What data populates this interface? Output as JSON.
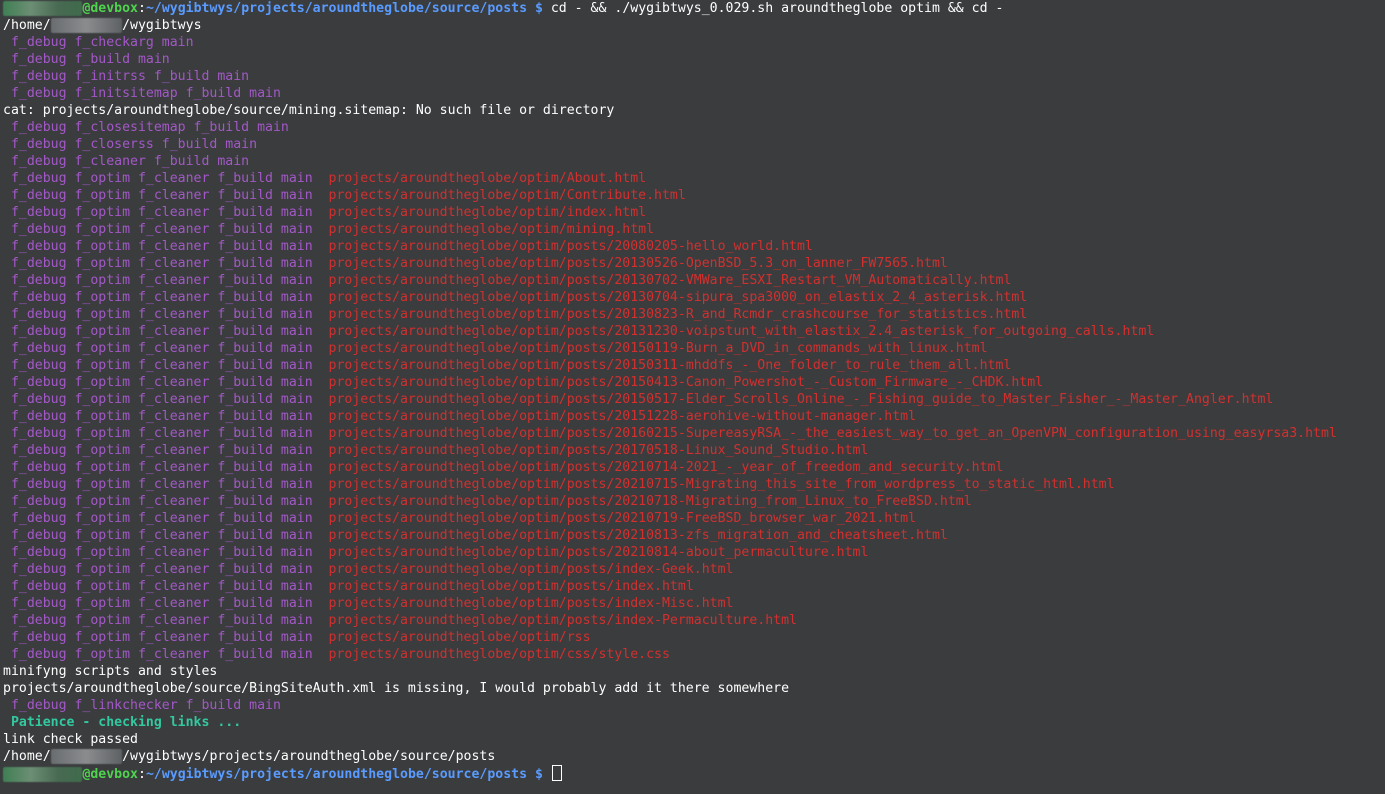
{
  "terminal": {
    "lines": [
      [
        {
          "c": "redact",
          "t": "xxxxxxxxxx"
        },
        {
          "c": "green",
          "t": "@devbox"
        },
        {
          "c": "white",
          "t": ":"
        },
        {
          "c": "blue",
          "t": "~/wygibtwys/projects/aroundtheglobe/source/posts $"
        },
        {
          "c": "white",
          "t": " cd - && ./wygibtwys_0.029.sh aroundtheglobe optim && cd -"
        }
      ],
      [
        {
          "c": "white",
          "t": "/home/"
        },
        {
          "c": "redact-grey",
          "t": "xxxxxxxxx"
        },
        {
          "c": "white",
          "t": "/wygibtwys"
        }
      ],
      [
        {
          "c": "purple",
          "t": " f_debug f_checkarg main"
        }
      ],
      [
        {
          "c": "purple",
          "t": " f_debug f_build main"
        }
      ],
      [
        {
          "c": "purple",
          "t": " f_debug f_initrss f_build main"
        }
      ],
      [
        {
          "c": "purple",
          "t": " f_debug f_initsitemap f_build main"
        }
      ],
      [
        {
          "c": "white",
          "t": "cat: projects/aroundtheglobe/source/mining.sitemap: No such file or directory"
        }
      ],
      [
        {
          "c": "purple",
          "t": " f_debug f_closesitemap f_build main"
        }
      ],
      [
        {
          "c": "purple",
          "t": " f_debug f_closerss f_build main"
        }
      ],
      [
        {
          "c": "purple",
          "t": " f_debug f_cleaner f_build main"
        }
      ],
      [
        {
          "c": "purple",
          "t": " f_debug f_optim f_cleaner f_build main "
        },
        {
          "c": "red",
          "t": " projects/aroundtheglobe/optim/About.html"
        }
      ],
      [
        {
          "c": "purple",
          "t": " f_debug f_optim f_cleaner f_build main "
        },
        {
          "c": "red",
          "t": " projects/aroundtheglobe/optim/Contribute.html"
        }
      ],
      [
        {
          "c": "purple",
          "t": " f_debug f_optim f_cleaner f_build main "
        },
        {
          "c": "red",
          "t": " projects/aroundtheglobe/optim/index.html"
        }
      ],
      [
        {
          "c": "purple",
          "t": " f_debug f_optim f_cleaner f_build main "
        },
        {
          "c": "red",
          "t": " projects/aroundtheglobe/optim/mining.html"
        }
      ],
      [
        {
          "c": "purple",
          "t": " f_debug f_optim f_cleaner f_build main "
        },
        {
          "c": "red",
          "t": " projects/aroundtheglobe/optim/posts/20080205-hello_world.html"
        }
      ],
      [
        {
          "c": "purple",
          "t": " f_debug f_optim f_cleaner f_build main "
        },
        {
          "c": "red",
          "t": " projects/aroundtheglobe/optim/posts/20130526-OpenBSD_5.3_on_lanner_FW7565.html"
        }
      ],
      [
        {
          "c": "purple",
          "t": " f_debug f_optim f_cleaner f_build main "
        },
        {
          "c": "red",
          "t": " projects/aroundtheglobe/optim/posts/20130702-VMWare_ESXI_Restart_VM_Automatically.html"
        }
      ],
      [
        {
          "c": "purple",
          "t": " f_debug f_optim f_cleaner f_build main "
        },
        {
          "c": "red",
          "t": " projects/aroundtheglobe/optim/posts/20130704-sipura_spa3000_on_elastix_2_4_asterisk.html"
        }
      ],
      [
        {
          "c": "purple",
          "t": " f_debug f_optim f_cleaner f_build main "
        },
        {
          "c": "red",
          "t": " projects/aroundtheglobe/optim/posts/20130823-R_and_Rcmdr_crashcourse_for_statistics.html"
        }
      ],
      [
        {
          "c": "purple",
          "t": " f_debug f_optim f_cleaner f_build main "
        },
        {
          "c": "red",
          "t": " projects/aroundtheglobe/optim/posts/20131230-voipstunt_with_elastix_2.4_asterisk_for_outgoing_calls.html"
        }
      ],
      [
        {
          "c": "purple",
          "t": " f_debug f_optim f_cleaner f_build main "
        },
        {
          "c": "red",
          "t": " projects/aroundtheglobe/optim/posts/20150119-Burn_a_DVD_in_commands_with_linux.html"
        }
      ],
      [
        {
          "c": "purple",
          "t": " f_debug f_optim f_cleaner f_build main "
        },
        {
          "c": "red",
          "t": " projects/aroundtheglobe/optim/posts/20150311-mhddfs_-_One_folder_to_rule_them_all.html"
        }
      ],
      [
        {
          "c": "purple",
          "t": " f_debug f_optim f_cleaner f_build main "
        },
        {
          "c": "red",
          "t": " projects/aroundtheglobe/optim/posts/20150413-Canon_Powershot_-_Custom_Firmware_-_CHDK.html"
        }
      ],
      [
        {
          "c": "purple",
          "t": " f_debug f_optim f_cleaner f_build main "
        },
        {
          "c": "red",
          "t": " projects/aroundtheglobe/optim/posts/20150517-Elder_Scrolls_Online_-_Fishing_guide_to_Master_Fisher_-_Master_Angler.html"
        }
      ],
      [
        {
          "c": "purple",
          "t": " f_debug f_optim f_cleaner f_build main "
        },
        {
          "c": "red",
          "t": " projects/aroundtheglobe/optim/posts/20151228-aerohive-without-manager.html"
        }
      ],
      [
        {
          "c": "purple",
          "t": " f_debug f_optim f_cleaner f_build main "
        },
        {
          "c": "red",
          "t": " projects/aroundtheglobe/optim/posts/20160215-SupereasyRSA_-_the_easiest_way_to_get_an_OpenVPN_configuration_using_easyrsa3.html"
        }
      ],
      [
        {
          "c": "purple",
          "t": " f_debug f_optim f_cleaner f_build main "
        },
        {
          "c": "red",
          "t": " projects/aroundtheglobe/optim/posts/20170518-Linux_Sound_Studio.html"
        }
      ],
      [
        {
          "c": "purple",
          "t": " f_debug f_optim f_cleaner f_build main "
        },
        {
          "c": "red",
          "t": " projects/aroundtheglobe/optim/posts/20210714-2021_-_year_of_freedom_and_security.html"
        }
      ],
      [
        {
          "c": "purple",
          "t": " f_debug f_optim f_cleaner f_build main "
        },
        {
          "c": "red",
          "t": " projects/aroundtheglobe/optim/posts/20210715-Migrating_this_site_from_wordpress_to_static_html.html"
        }
      ],
      [
        {
          "c": "purple",
          "t": " f_debug f_optim f_cleaner f_build main "
        },
        {
          "c": "red",
          "t": " projects/aroundtheglobe/optim/posts/20210718-Migrating_from_Linux_to_FreeBSD.html"
        }
      ],
      [
        {
          "c": "purple",
          "t": " f_debug f_optim f_cleaner f_build main "
        },
        {
          "c": "red",
          "t": " projects/aroundtheglobe/optim/posts/20210719-FreeBSD_browser_war_2021.html"
        }
      ],
      [
        {
          "c": "purple",
          "t": " f_debug f_optim f_cleaner f_build main "
        },
        {
          "c": "red",
          "t": " projects/aroundtheglobe/optim/posts/20210813-zfs_migration_and_cheatsheet.html"
        }
      ],
      [
        {
          "c": "purple",
          "t": " f_debug f_optim f_cleaner f_build main "
        },
        {
          "c": "red",
          "t": " projects/aroundtheglobe/optim/posts/20210814-about_permaculture.html"
        }
      ],
      [
        {
          "c": "purple",
          "t": " f_debug f_optim f_cleaner f_build main "
        },
        {
          "c": "red",
          "t": " projects/aroundtheglobe/optim/posts/index-Geek.html"
        }
      ],
      [
        {
          "c": "purple",
          "t": " f_debug f_optim f_cleaner f_build main "
        },
        {
          "c": "red",
          "t": " projects/aroundtheglobe/optim/posts/index.html"
        }
      ],
      [
        {
          "c": "purple",
          "t": " f_debug f_optim f_cleaner f_build main "
        },
        {
          "c": "red",
          "t": " projects/aroundtheglobe/optim/posts/index-Misc.html"
        }
      ],
      [
        {
          "c": "purple",
          "t": " f_debug f_optim f_cleaner f_build main "
        },
        {
          "c": "red",
          "t": " projects/aroundtheglobe/optim/posts/index-Permaculture.html"
        }
      ],
      [
        {
          "c": "purple",
          "t": " f_debug f_optim f_cleaner f_build main "
        },
        {
          "c": "red",
          "t": " projects/aroundtheglobe/optim/rss"
        }
      ],
      [
        {
          "c": "purple",
          "t": " f_debug f_optim f_cleaner f_build main "
        },
        {
          "c": "red",
          "t": " projects/aroundtheglobe/optim/css/style.css"
        }
      ],
      [
        {
          "c": "white",
          "t": "minifyng scripts and styles"
        }
      ],
      [
        {
          "c": "white",
          "t": "projects/aroundtheglobe/source/BingSiteAuth.xml is missing, I would probably add it there somewhere"
        }
      ],
      [
        {
          "c": "purple",
          "t": " f_debug f_linkchecker f_build main"
        }
      ],
      [
        {
          "c": "cyan",
          "t": " Patience - checking links ..."
        }
      ],
      [
        {
          "c": "white",
          "t": "link check passed"
        }
      ],
      [
        {
          "c": "white",
          "t": "/home/"
        },
        {
          "c": "redact-grey",
          "t": "xxxxxxxxx"
        },
        {
          "c": "white",
          "t": "/wygibtwys/projects/aroundtheglobe/source/posts"
        }
      ],
      [
        {
          "c": "redact",
          "t": "xxxxxxxxxx"
        },
        {
          "c": "green",
          "t": "@devbox"
        },
        {
          "c": "white",
          "t": ":"
        },
        {
          "c": "blue",
          "t": "~/wygibtwys/projects/aroundtheglobe/source/posts $"
        },
        {
          "c": "white",
          "t": " "
        }
      ]
    ]
  },
  "colors": {
    "background": "#3a3c3e",
    "text": "#ffffff",
    "prompt_user": "#4fd34f",
    "prompt_path": "#5a9bff",
    "debug": "#a358c7",
    "path_output": "#d2302f",
    "notice": "#33c9a0"
  }
}
